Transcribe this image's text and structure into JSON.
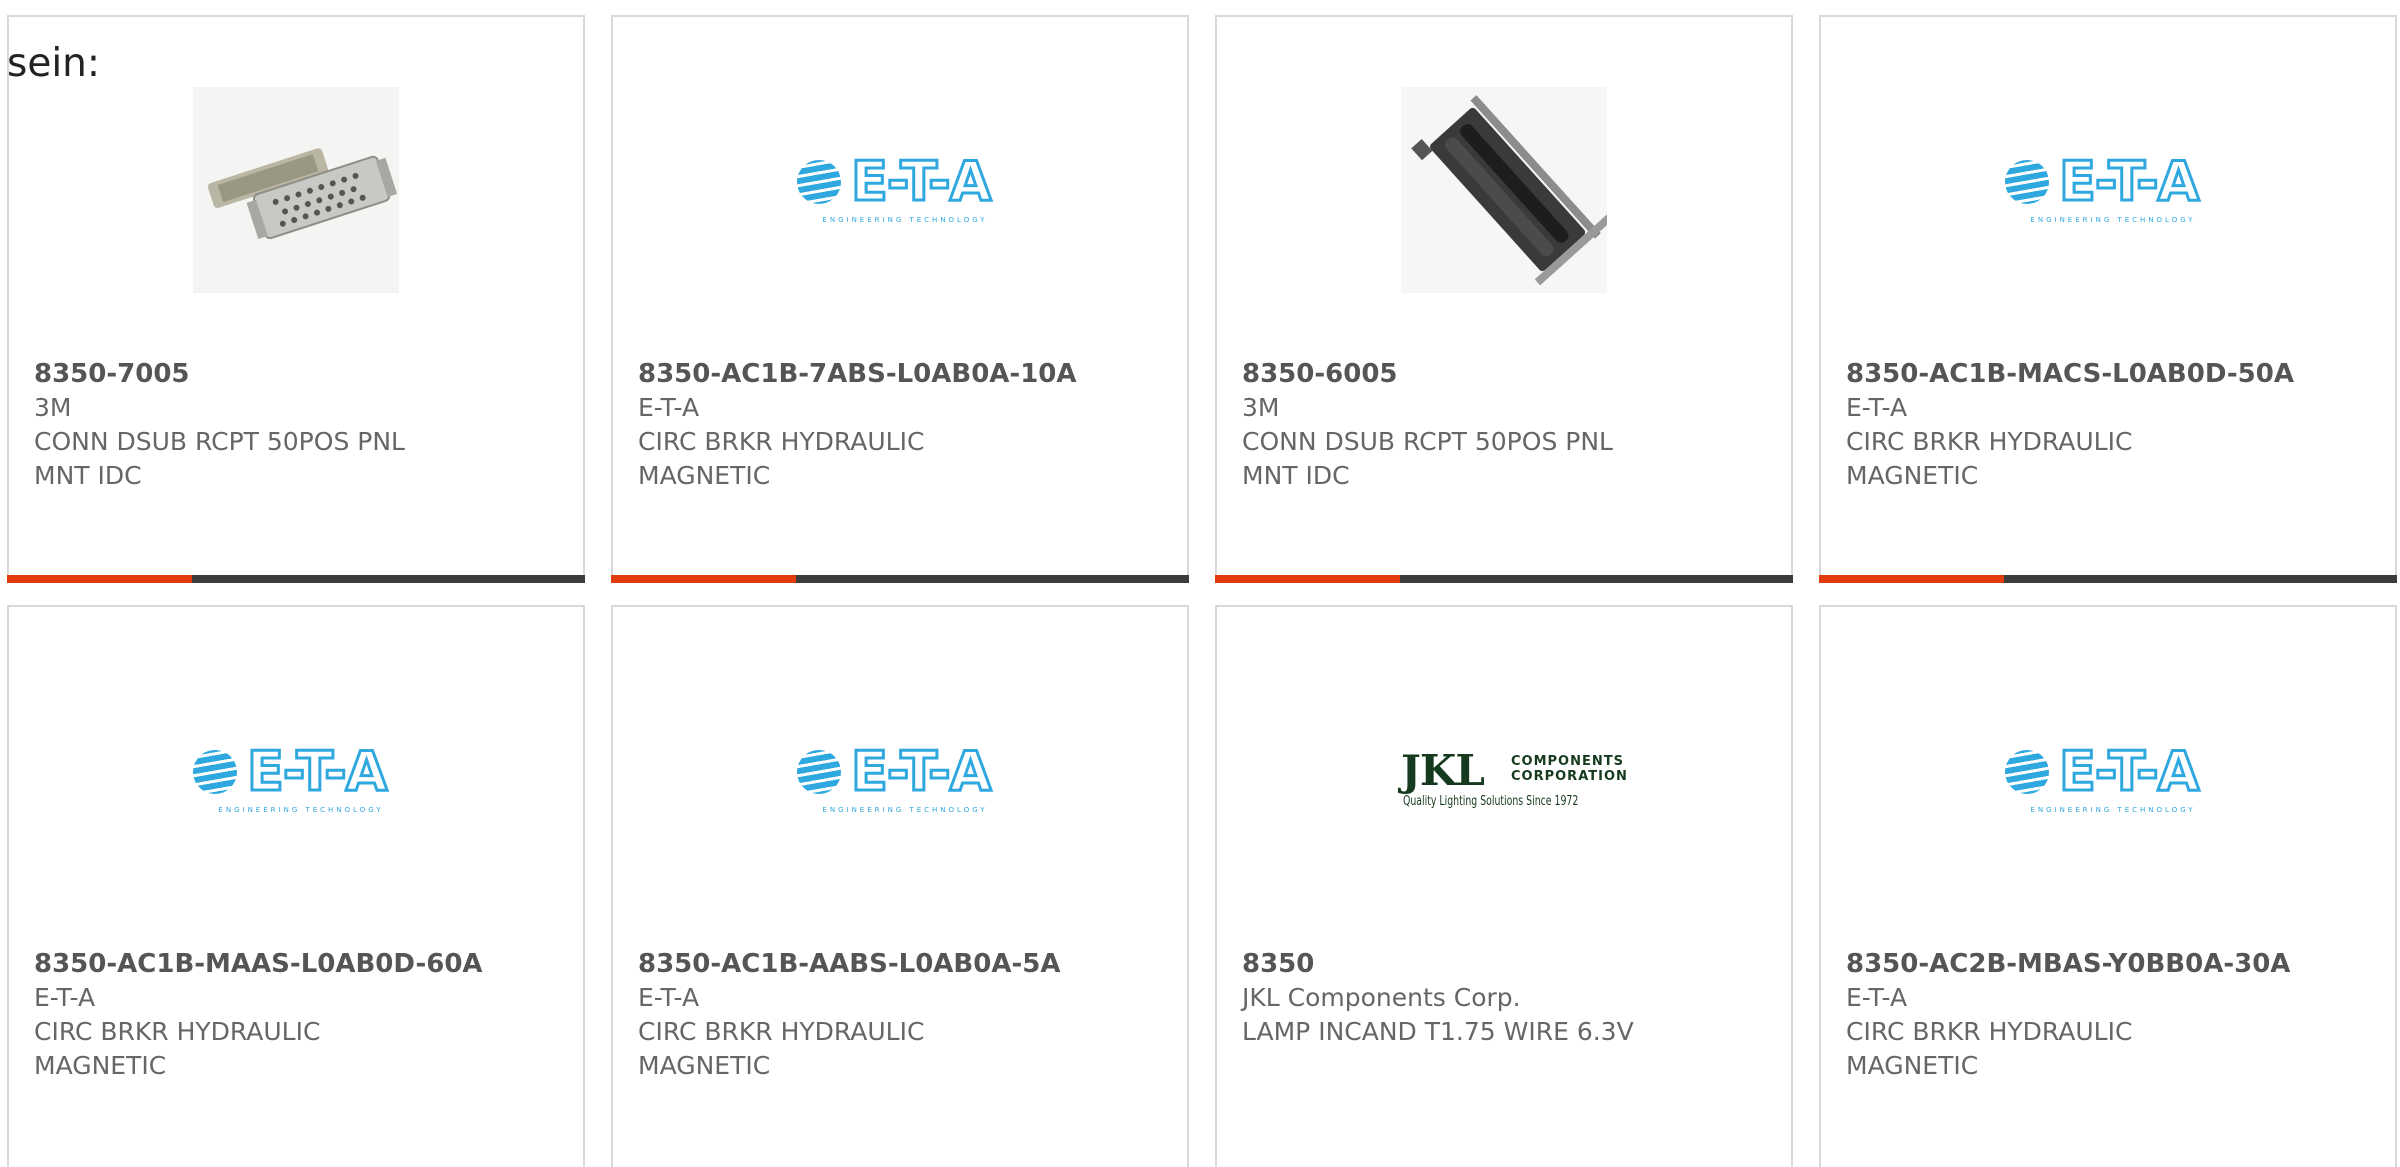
{
  "intro_text": "sein:",
  "colors": {
    "accent": "#e23c0c",
    "bar": "#3c3c3c",
    "border": "#d9d9d9",
    "text": "#666666",
    "eta_blue": "#2fa8e0",
    "jkl_green": "#163a1d"
  },
  "products": [
    {
      "part_number": "8350-7005",
      "manufacturer": "3M",
      "description": "CONN DSUB RCPT 50POS PNL MNT IDC",
      "image": "dsub-connector-photo",
      "progress": 0.32
    },
    {
      "part_number": "8350-AC1B-7ABS-L0AB0A-10A",
      "manufacturer": "E-T-A",
      "description": "CIRC BRKR HYDRAULIC MAGNETIC",
      "image": "eta-logo",
      "progress": 0.32
    },
    {
      "part_number": "8350-6005",
      "manufacturer": "3M",
      "description": "CONN DSUB RCPT 50POS PNL MNT IDC",
      "image": "dsub-connector-photo-angled",
      "progress": 0.32
    },
    {
      "part_number": "8350-AC1B-MACS-L0AB0D-50A",
      "manufacturer": "E-T-A",
      "description": "CIRC BRKR HYDRAULIC MAGNETIC",
      "image": "eta-logo",
      "progress": 0.32
    },
    {
      "part_number": "8350-AC1B-MAAS-L0AB0D-60A",
      "manufacturer": "E-T-A",
      "description": "CIRC BRKR HYDRAULIC MAGNETIC",
      "image": "eta-logo"
    },
    {
      "part_number": "8350-AC1B-AABS-L0AB0A-5A",
      "manufacturer": "E-T-A",
      "description": "CIRC BRKR HYDRAULIC MAGNETIC",
      "image": "eta-logo"
    },
    {
      "part_number": "8350",
      "manufacturer": "JKL Components Corp.",
      "description": "LAMP INCAND T1.75 WIRE 6.3V",
      "image": "jkl-logo"
    },
    {
      "part_number": "8350-AC2B-MBAS-Y0BB0A-30A",
      "manufacturer": "E-T-A",
      "description": "CIRC BRKR HYDRAULIC MAGNETIC",
      "image": "eta-logo"
    }
  ],
  "logos": {
    "eta": {
      "wordmark": "E-T-A",
      "registered": "®",
      "tagline": "ENGINEERING TECHNOLOGY"
    },
    "jkl": {
      "wordmark": "JKL",
      "corp_line1": "COMPONENTS",
      "corp_line2": "CORPORATION",
      "tagline": "Quality Lighting Solutions Since 1972"
    }
  }
}
